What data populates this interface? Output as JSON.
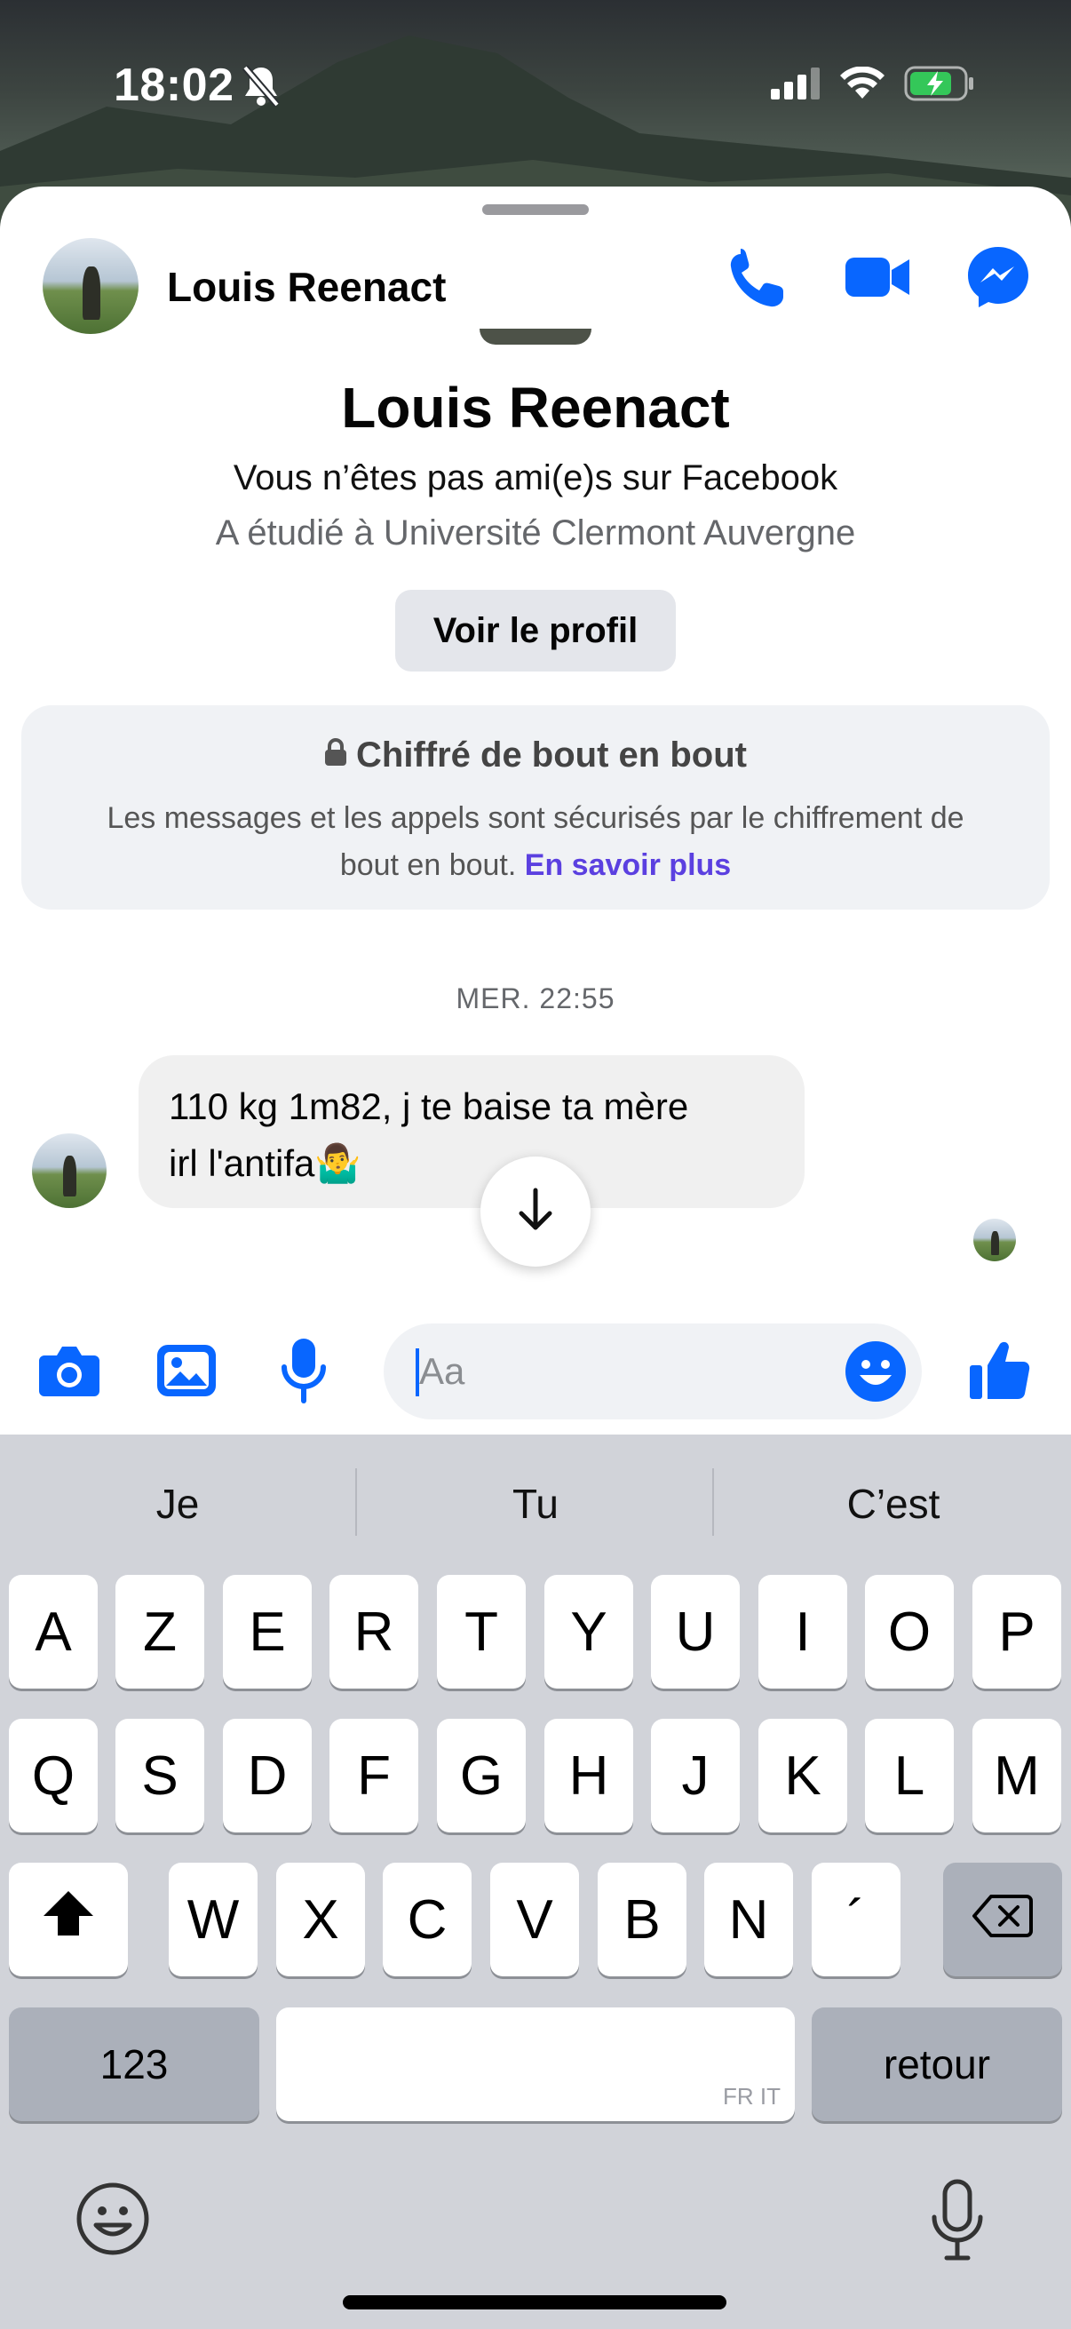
{
  "status_bar": {
    "time": "18:02"
  },
  "header": {
    "name": "Louis Reenact"
  },
  "profile": {
    "name": "Louis Reenact",
    "relation": "Vous n’êtes pas ami(e)s sur Facebook",
    "education": "A étudié à Université Clermont Auvergne",
    "view_profile_label": "Voir le profil"
  },
  "encryption": {
    "title": "Chiffré de bout en bout",
    "body_line1": "Les messages et les appels sont sécurisés par le chiffrement de",
    "body_line2": "bout en bout.",
    "learn_more": "En savoir plus"
  },
  "conversation": {
    "timestamp": "MER. 22:55",
    "messages": [
      {
        "line1": "110 kg 1m82, j te baise ta mère",
        "line2": "irl l'antifa🤷‍♂️"
      }
    ]
  },
  "composer": {
    "placeholder": "Aa"
  },
  "keyboard": {
    "suggestions": [
      "Je",
      "Tu",
      "C’est"
    ],
    "row1": [
      "A",
      "Z",
      "E",
      "R",
      "T",
      "Y",
      "U",
      "I",
      "O",
      "P"
    ],
    "row2": [
      "Q",
      "S",
      "D",
      "F",
      "G",
      "H",
      "J",
      "K",
      "L",
      "M"
    ],
    "row3": [
      "W",
      "X",
      "C",
      "V",
      "B",
      "N",
      "´"
    ],
    "numbers_key": "123",
    "return_key": "retour",
    "space_language": "FR IT"
  },
  "colors": {
    "accent": "#0866FF",
    "link": "#5B40E0",
    "bubble": "#F0F0F0"
  }
}
